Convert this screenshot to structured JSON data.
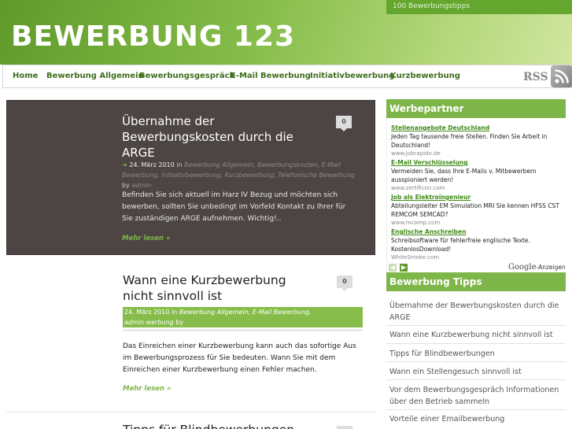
{
  "site": {
    "title": "BEWERBUNG 123",
    "tagline": "100 Bewerbungstipps"
  },
  "nav": {
    "items": [
      "Home",
      "Bewerbung Allgemein",
      "Bewerbungsgespräch",
      "E-Mail Bewerbung",
      "Initiativbewerbung",
      "Kurzbewerbung"
    ],
    "rss": "RSS"
  },
  "posts": [
    {
      "title_lines": [
        "Übernahme der",
        "Bewerbungskosten durch die",
        "ARGE"
      ],
      "comments": "0",
      "date": "24. März 2010",
      "in": "in",
      "categories": "Bewerbung Allgemein, Bewerbungskosten, E-Mail Bewerbung, Initiativbewerbung, Kurzbewerbung, Telefonische Bewerbung",
      "by": "by",
      "author": "admin",
      "excerpt": "Befinden Sie sich aktuell im Harz IV Bezug und möchten sich bewerben, sollten Sie unbedingt im Vorfeld Kontakt zu Ihrer für Sie zuständigen ARGE aufnehmen. Wichtig!..",
      "more": "Mehr lesen »"
    },
    {
      "title_lines": [
        "Wann eine Kurzbewerbung",
        "nicht sinnvoll ist"
      ],
      "comments": "0",
      "date": "24. März 2010",
      "in": "in",
      "categories": "Bewerbung Allgemein, E-Mail Bewerbung, Kurzbewerbung",
      "by": "by",
      "author": "admin",
      "excerpt": "Das Einreichen einer Kurzbewerbung kann auch das sofortige Aus im Bewerbungsprozess für Sie bedeuten. Wann Sie mit dem Einreichen einer Kurzbewerbung einen Fehler machen.",
      "more": "Mehr lesen »"
    },
    {
      "title_partial": "Tipps für Blindbewerbungen",
      "comments": "0"
    }
  ],
  "sidebar": {
    "partners_title": "Werbepartner",
    "ads": [
      {
        "title": "Stellenangebote Deutschland",
        "text": "Jeden Tag tausende freie Stellen. Finden Sie Arbeit in Deutschland!",
        "url": "www.Jobrapido.de"
      },
      {
        "title": "E-Mail Verschlüsselung",
        "text": "Vermeiden Sie, dass Ihre E-Mails v. Mitbewerbern ausspioniert werden!",
        "url": "www.zertificon.com"
      },
      {
        "title": "Job als Elektroingenieur",
        "text": "Abteilungsleiter EM Simulation MRI Sie kennen HFSS CST REMCOM SEMCAD?",
        "url": "www.mcomp.com"
      },
      {
        "title": "Englische Anschreiben",
        "text": "Schreibsoftware für fehlerfreie englische Texte. KostenlosDownload!",
        "url": "WhiteSmoke.com"
      }
    ],
    "ads_by": "Google",
    "ads_label": "-Anzeigen",
    "tips_title": "Bewerbung Tipps",
    "tips": [
      "Übernahme der Bewerbungskosten durch die ARGE",
      "Wann eine Kurzbewerbung nicht sinnvoll ist",
      "Tipps für Blindbewerbungen",
      "Wann ein Stellengesuch sinnvoll ist",
      "Vor dem Bewerbungsgespräch Informationen über den Betrieb sammeln",
      "Vorteile einer Emailbewerbung"
    ]
  },
  "colors": {
    "brand_green": "#7fb649",
    "dark_post": "#4c4544",
    "link_green": "#3f6e1c"
  }
}
